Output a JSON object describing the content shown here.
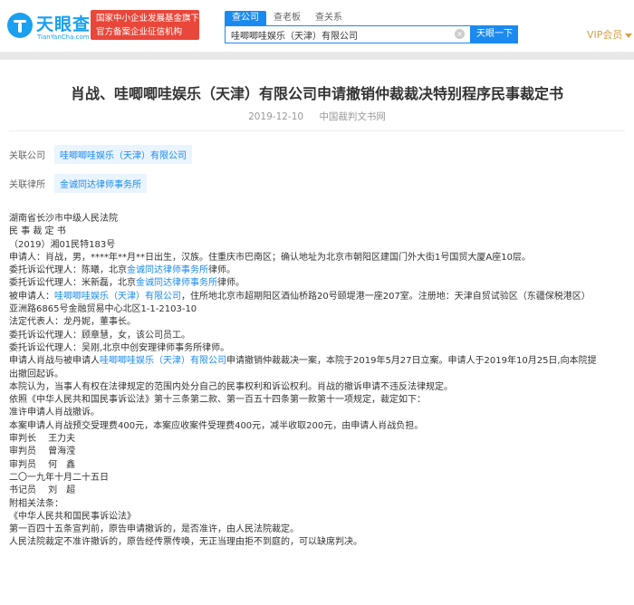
{
  "header": {
    "logo_name": "天眼查",
    "logo_sub": "TianYanCha.com",
    "badge_line1": "国家中小企业发展基金旗下",
    "badge_line2": "官方备案企业征信机构",
    "tabs": [
      "查公司",
      "查老板",
      "查关系"
    ],
    "search_value": "哇唧唧哇娱乐（天津）有限公司",
    "clear_icon": "×",
    "search_button": "天眼一下",
    "vip_label": "VIP会员",
    "accent": "#1a8af0",
    "badge_color": "#e8473a"
  },
  "doc": {
    "title": "肖战、哇唧唧哇娱乐（天津）有限公司申请撤销仲裁裁决特别程序民事裁定书",
    "date": "2019-12-10",
    "source": "中国裁判文书网",
    "rel_company_label": "关联公司",
    "rel_company": "哇唧唧哇娱乐（天津）有限公司",
    "rel_lawyer_label": "关联律所",
    "rel_lawyer": "金诚同达律师事务所",
    "lines": [
      [
        {
          "t": "湖南省长沙市中级人民法院"
        }
      ],
      [
        {
          "t": "民 事 裁 定 书"
        }
      ],
      [
        {
          "t": "（2019）湘01民特183号"
        }
      ],
      [
        {
          "t": "申请人：肖战，男，****年**月**日出生，汉族。住重庆市巴南区；确认地址为北京市朝阳区建国门外大街1号国贸大厦A座10层。"
        }
      ],
      [
        {
          "t": "委托诉讼代理人：陈曦，北京"
        },
        {
          "t": "金诚同达律师事务所",
          "link": true
        },
        {
          "t": "律师。"
        }
      ],
      [
        {
          "t": "委托诉讼代理人：米新磊，北京"
        },
        {
          "t": "金诚同达律师事务所",
          "link": true
        },
        {
          "t": "律师。"
        }
      ],
      [
        {
          "t": "被申请人："
        },
        {
          "t": "哇唧唧哇娱乐（天津）有限公司",
          "link": true
        },
        {
          "t": "，住所地北京市超期阳区酒仙桥路20号颐堤港一座207室。注册地：天津自贸试验区（东疆保税港区）"
        }
      ],
      [
        {
          "t": "亚洲路6865号金融贸易中心北区1-1-2103-10"
        }
      ],
      [
        {
          "t": "法定代表人：龙丹妮，董事长。"
        }
      ],
      [
        {
          "t": "委托诉讼代理人：顾章慧，女，该公司员工。"
        }
      ],
      [
        {
          "t": "委托诉讼代理人：吴刚,北京中创安理律师事务所律师。"
        }
      ],
      [
        {
          "t": "申请人肖战与被申请人"
        },
        {
          "t": "哇唧唧哇娱乐（天津）有限公司",
          "link": true
        },
        {
          "t": "申请撤销仲裁裁决一案，本院于2019年5月27日立案。申请人于2019年10月25日,向本院提"
        }
      ],
      [
        {
          "t": "出撤回起诉。"
        }
      ],
      [
        {
          "t": "本院认为，当事人有权在法律规定的范围内处分自己的民事权利和诉讼权利。肖战的撤诉申请不违反法律规定。"
        }
      ],
      [
        {
          "t": "依照《中华人民共和国民事诉讼法》第十三条第二款、第一百五十四条第一款第十一项规定，裁定如下："
        }
      ],
      [
        {
          "t": "准许申请人肖战撤诉。"
        }
      ],
      [
        {
          "t": "本案申请人肖战预交受理费400元，本案应收案件受理费400元，减半收取200元，由申请人肖战负担。"
        }
      ],
      [
        {
          "t": "审判长　 王力夫"
        }
      ],
      [
        {
          "t": "审判员　 曾海滢"
        }
      ],
      [
        {
          "t": "审判员　 何　鑫"
        }
      ],
      [
        {
          "t": "二〇一九年十月二十五日"
        }
      ],
      [
        {
          "t": "书记员　 刘　超"
        }
      ],
      [
        {
          "t": "附相关法条："
        }
      ],
      [
        {
          "t": "《中华人民共和国民事诉讼法》"
        }
      ],
      [
        {
          "t": "第一百四十五条宣判前，原告申请撤诉的，是否准许，由人民法院裁定。"
        }
      ],
      [
        {
          "t": "人民法院裁定不准许撤诉的，原告经传票传唤，无正当理由拒不到庭的，可以缺席判决。"
        }
      ]
    ]
  }
}
